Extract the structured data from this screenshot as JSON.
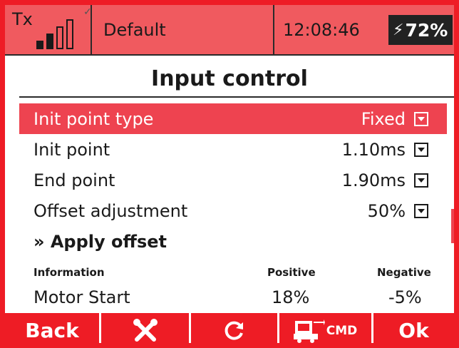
{
  "status_bar": {
    "tx_label": "Tx",
    "signal_level": 4,
    "model_name": "Default",
    "time": "12:08:46",
    "battery_percent": "72%",
    "charging": true
  },
  "title": "Input control",
  "items": [
    {
      "label": "Init point type",
      "value": "Fixed",
      "selected": true
    },
    {
      "label": "Init point",
      "value": "1.10ms",
      "selected": false
    },
    {
      "label": "End point",
      "value": "1.90ms",
      "selected": false
    },
    {
      "label": "Offset adjustment",
      "value": "50%",
      "selected": false
    }
  ],
  "apply_offset": "» Apply offset",
  "info": {
    "headers": [
      "Information",
      "Positive",
      "Negative"
    ],
    "row": {
      "label": "Motor Start",
      "positive": "18%",
      "negative": "-5%"
    }
  },
  "bottom_bar": {
    "back": "Back",
    "ok": "Ok",
    "cmd": "CMD",
    "icons": [
      "tools-icon",
      "refresh-icon",
      "cmd-icon"
    ]
  },
  "colors": {
    "accent": "#ee1c25",
    "selected_row": "#ee4350",
    "status_bar": "#f05a5f"
  }
}
